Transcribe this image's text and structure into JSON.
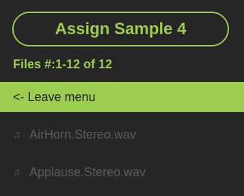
{
  "header": {
    "title": "Assign Sample 4",
    "files_count": "Files #:1-12 of 12"
  },
  "menu": {
    "items": [
      {
        "label": "<- Leave menu",
        "icon": "",
        "selected": true
      },
      {
        "label": "AirHorn.Stereo.wav",
        "icon": "music-note-icon",
        "selected": false
      },
      {
        "label": "Applause.Stereo.wav",
        "icon": "music-note-icon",
        "selected": false
      }
    ]
  },
  "colors": {
    "accent": "#9ccc50",
    "background": "#262626",
    "muted_text": "#5c5c5c"
  }
}
